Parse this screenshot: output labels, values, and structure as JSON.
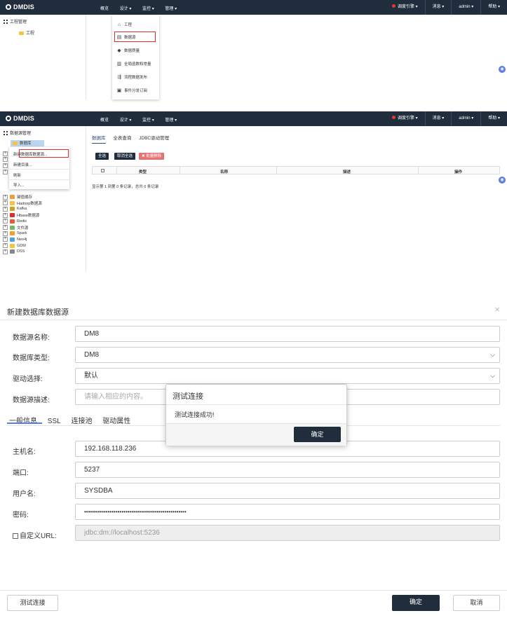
{
  "app": {
    "logo": "DMDIS"
  },
  "topnav": {
    "overview": "概览",
    "design": "设计 ▾",
    "monitor": "监控 ▾",
    "manage": "管理 ▾"
  },
  "topright": {
    "engine": "调度引擎 ▾",
    "messages": "消息 ▾",
    "user": "admin ▾",
    "help": "帮助 ▾"
  },
  "colors": {
    "navbar": "#1f2d3d",
    "highlight": "#d9302c",
    "accent": "#5b7de6"
  },
  "s1": {
    "sidebar_title": "工程管理",
    "project_node": "工程",
    "design_menu": [
      {
        "icon": "project-icon",
        "label": "工程"
      },
      {
        "icon": "database-icon",
        "label": "数据源"
      },
      {
        "icon": "quality-icon",
        "label": "数据质量"
      },
      {
        "icon": "chart-icon",
        "label": "全局函数和常量"
      },
      {
        "icon": "publish-icon",
        "label": "流程数据发布"
      },
      {
        "icon": "subscribe-icon",
        "label": "事件分发订阅"
      }
    ]
  },
  "s2": {
    "sidebar_title": "数据源管理",
    "root_node": "数据库",
    "context_menu": {
      "new_db_source": "新建数据库数据源...",
      "new_dir": "新建目录...",
      "refresh": "刷新",
      "import": "导入..."
    },
    "tree": [
      {
        "label": "键值缓存",
        "color": "#f0a030"
      },
      {
        "label": "Hadoop数据源",
        "color": "#f6c342"
      },
      {
        "label": "Kafka",
        "color": "#c9a227"
      },
      {
        "label": "Hbase数据源",
        "color": "#d9302c"
      },
      {
        "label": "Redis",
        "color": "#e85d2a"
      },
      {
        "label": "文件源",
        "color": "#7bb661"
      },
      {
        "label": "Spark",
        "color": "#f0a030"
      },
      {
        "label": "Neo4j",
        "color": "#4aa3df"
      },
      {
        "label": "GDM",
        "color": "#f6c342"
      },
      {
        "label": "DSS",
        "color": "#888888"
      }
    ],
    "tabs": [
      "数据库",
      "全表查询",
      "JDBC驱动管理"
    ],
    "buttons": {
      "select_all": "全选",
      "unselect_all": "取消全选",
      "batch_delete": "✖ 批量删除"
    },
    "columns": {
      "type": "类型",
      "name": "名称",
      "desc": "描述",
      "ops": "操作"
    },
    "records": "显示第 1 到第 0 条记录，总共 0 条记录"
  },
  "dialog": {
    "title": "新建数据库数据源",
    "fields": {
      "name_label": "数据源名称:",
      "name_value": "DM8",
      "type_label": "数据库类型:",
      "type_value": "DM8",
      "driver_label": "驱动选择:",
      "driver_value": "默认",
      "desc_label": "数据源描述:",
      "desc_placeholder": "请输入相应的内容。"
    },
    "tabs": [
      "一般信息",
      "SSL",
      "连接池",
      "驱动属性"
    ],
    "conn": {
      "host_label": "主机名:",
      "host_value": "192.168.118.236",
      "port_label": "端口:",
      "port_value": "5237",
      "user_label": "用户名:",
      "user_value": "SYSDBA",
      "pwd_label": "密码:",
      "pwd_value": "••••••••••••••••••••••••••••••••••••••••••••••••••••",
      "url_label": "自定义URL:",
      "url_value": "jdbc:dm://localhost:5236"
    },
    "popup": {
      "title": "测试连接",
      "message": "测试连接成功!",
      "ok": "确定"
    },
    "footer": {
      "test": "测试连接",
      "ok": "确定",
      "cancel": "取消"
    }
  }
}
